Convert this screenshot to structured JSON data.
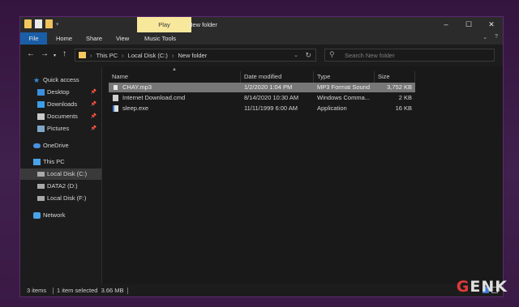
{
  "titlebar": {
    "context_tab": "Play",
    "title": "New folder",
    "minimize": "–",
    "maximize": "☐",
    "close": "✕"
  },
  "ribbon": {
    "tabs": [
      "File",
      "Home",
      "Share",
      "View",
      "Music Tools"
    ],
    "collapse_icon": "chevron-down",
    "help_icon": "?"
  },
  "address": {
    "path": [
      "This PC",
      "Local Disk (C:)",
      "New folder"
    ],
    "separator": "›"
  },
  "search": {
    "placeholder": "Search New folder"
  },
  "nav_pane": {
    "items": [
      {
        "label": "Quick access",
        "icon": "star-icon",
        "pinned": false
      },
      {
        "label": "Desktop",
        "icon": "desktop-icon",
        "pinned": true
      },
      {
        "label": "Downloads",
        "icon": "downloads-icon",
        "pinned": true
      },
      {
        "label": "Documents",
        "icon": "documents-icon",
        "pinned": true
      },
      {
        "label": "Pictures",
        "icon": "pictures-icon",
        "pinned": true
      },
      {
        "label": "OneDrive",
        "icon": "cloud-icon",
        "pinned": false
      },
      {
        "label": "This PC",
        "icon": "computer-icon",
        "pinned": false
      },
      {
        "label": "Local Disk (C:)",
        "icon": "disk-icon",
        "pinned": false,
        "selected": true
      },
      {
        "label": "DATA2 (D:)",
        "icon": "disk-icon",
        "pinned": false
      },
      {
        "label": "Local Disk (F:)",
        "icon": "disk-icon",
        "pinned": false
      },
      {
        "label": "Network",
        "icon": "network-icon",
        "pinned": false
      }
    ]
  },
  "file_list": {
    "columns": [
      "Name",
      "Date modified",
      "Type",
      "Size"
    ],
    "rows": [
      {
        "name": "CHAY.mp3",
        "date": "1/2/2020 1:04 PM",
        "type": "MP3 Format Sound",
        "size": "3,752 KB",
        "selected": true,
        "icon": "audio-file-icon"
      },
      {
        "name": "Internet Download.cmd",
        "date": "8/14/2020 10:30 AM",
        "type": "Windows Comma...",
        "size": "2 KB",
        "selected": false,
        "icon": "script-file-icon"
      },
      {
        "name": "sleep.exe",
        "date": "11/11/1999 6:00 AM",
        "type": "Application",
        "size": "16 KB",
        "selected": false,
        "icon": "exe-file-icon"
      }
    ]
  },
  "status": {
    "items": "3 items",
    "selection": "1 item selected  3.66 MB"
  },
  "watermark": {
    "text_prefix": "G",
    "text_rest": "ENK"
  }
}
